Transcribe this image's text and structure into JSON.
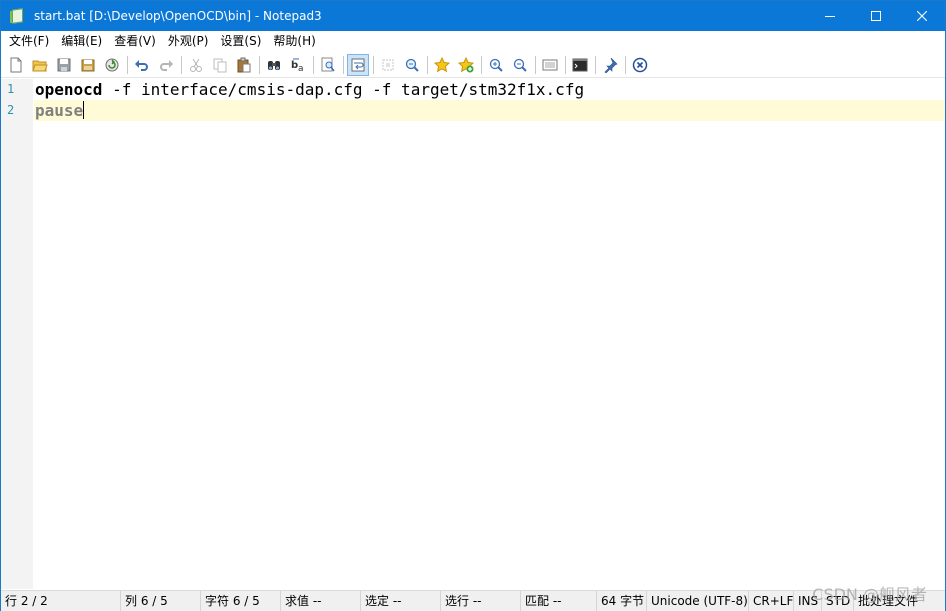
{
  "window": {
    "title": "start.bat [D:\\Develop\\OpenOCD\\bin] - Notepad3",
    "controls": [
      "minimize-icon",
      "maximize-icon",
      "close-icon"
    ],
    "titlebar_color": "#0b78d7"
  },
  "menu": {
    "items": [
      "文件(F)",
      "编辑(E)",
      "查看(V)",
      "外观(P)",
      "设置(S)",
      "帮助(H)"
    ]
  },
  "toolbar": {
    "buttons": [
      "new-file-icon",
      "open-folder-icon",
      "save-icon",
      "save-as-icon",
      "revert-icon",
      "undo-icon",
      "redo-icon",
      "cut-icon",
      "copy-icon",
      "paste-icon",
      "find-icon",
      "replace-icon",
      "find-in-file-icon",
      "word-wrap-icon",
      "select-all-icon",
      "goto-icon",
      "favorites-icon",
      "add-favorite-icon",
      "zoom-in-icon",
      "zoom-out-icon",
      "schemes-icon",
      "command-prompt-icon",
      "pin-icon",
      "exit-icon"
    ],
    "active_button": "word-wrap-icon"
  },
  "editor": {
    "lines": [
      {
        "number": "1",
        "keyword": "openocd",
        "rest": " -f interface/cmsis-dap.cfg -f target/stm32f1x.cfg"
      },
      {
        "number": "2",
        "keyword": "pause",
        "rest": ""
      }
    ],
    "current_line": 2,
    "current_line_color": "#fffbd6",
    "line_number_color": "#2b91af"
  },
  "statusbar": {
    "line": "行  2 / 2",
    "column": "列  6 / 5",
    "chars": "字符  6 / 5",
    "sum": "求值  --",
    "selection": "选定  --",
    "selected_lines": "选行  --",
    "match": "匹配  --",
    "bytes": "64 字节",
    "encoding": "Unicode (UTF-8)",
    "eol": "CR+LF",
    "ins": "INS",
    "mode": "STD",
    "lexer": "批处理文件"
  },
  "watermark": "CSDN @舰风者"
}
